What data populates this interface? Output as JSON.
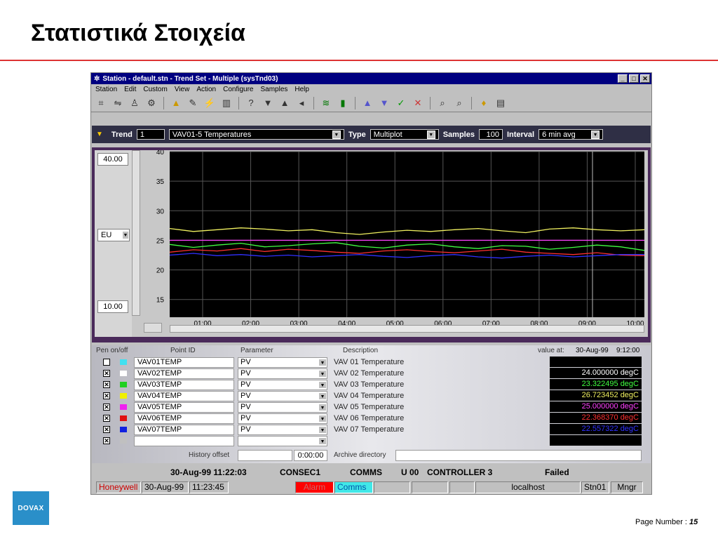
{
  "slide": {
    "title": "Στατιστικά Στοιχεία",
    "page_label": "Page Number :",
    "page_number": "15",
    "logo_text": "DOVAX"
  },
  "window": {
    "title": "Station - default.stn - Trend Set - Multiple (sysTnd03)",
    "menu": [
      "Station",
      "Edit",
      "Custom",
      "View",
      "Action",
      "Configure",
      "Samples",
      "Help"
    ]
  },
  "trendbar": {
    "trend_label": "Trend",
    "trend_value": "1",
    "set_value": "VAV01-5 Temperatures",
    "type_label": "Type",
    "type_value": "Multiplot",
    "samples_label": "Samples",
    "samples_value": "100",
    "interval_label": "Interval",
    "interval_value": "6 min avg"
  },
  "scale": {
    "high": "40.00",
    "low": "10.00",
    "unit": "EU"
  },
  "chart_data": {
    "type": "line",
    "y_ticks": [
      40,
      35,
      30,
      25,
      20,
      15
    ],
    "x_ticks": [
      "01:00",
      "02:00",
      "03:00",
      "04:00",
      "05:00",
      "06:00",
      "07:00",
      "08:00",
      "09:00",
      "10:00"
    ],
    "ylim": [
      12,
      40
    ],
    "series": [
      {
        "color": "#f0f060",
        "values": [
          27,
          26.5,
          26.8,
          27.1,
          26.9,
          26.6,
          26.8,
          26.3,
          26.0,
          26.4,
          26.7,
          26.5,
          26.8,
          27.0,
          26.6,
          26.3,
          26.9,
          27.1,
          26.8,
          26.6,
          26.8
        ]
      },
      {
        "color": "#ff40ff",
        "values": [
          25,
          25,
          25,
          25,
          25,
          25,
          25,
          25,
          25,
          25,
          25,
          25,
          25,
          25,
          25,
          25,
          25,
          25,
          25,
          25,
          25
        ]
      },
      {
        "color": "#40ff40",
        "values": [
          24.3,
          23.8,
          24.2,
          24.5,
          23.9,
          24.1,
          24.4,
          24.6,
          24.0,
          23.7,
          24.2,
          24.4,
          23.9,
          23.6,
          24.1,
          24.0,
          23.5,
          23.8,
          24.2,
          23.9,
          23.3
        ]
      },
      {
        "color": "#ff3030",
        "values": [
          23.0,
          23.4,
          23.2,
          23.6,
          23.1,
          23.5,
          23.3,
          23.0,
          22.8,
          23.2,
          23.4,
          23.1,
          22.9,
          23.2,
          23.5,
          23.0,
          22.8,
          22.6,
          22.9,
          22.5,
          22.4
        ]
      },
      {
        "color": "#3030ff",
        "values": [
          22.5,
          22.8,
          22.4,
          22.6,
          22.3,
          22.5,
          22.2,
          22.4,
          22.6,
          22.3,
          22.1,
          22.4,
          22.6,
          22.2,
          22.0,
          22.3,
          22.5,
          22.2,
          22.4,
          22.6,
          22.6
        ]
      }
    ]
  },
  "pens": {
    "headers": {
      "pen": "Pen on/off",
      "point": "Point ID",
      "param": "Parameter",
      "desc": "Description",
      "value_at": "value at:",
      "date": "30-Aug-99",
      "time": "9:12:00"
    },
    "rows": [
      {
        "on": "",
        "color": "#40e0f0",
        "point": "VAV01TEMP",
        "param": "PV",
        "desc": "VAV 01 Temperature",
        "value": "",
        "vcolor": "#ffffff"
      },
      {
        "on": "✕",
        "color": "#ffffff",
        "point": "VAV02TEMP",
        "param": "PV",
        "desc": "VAV 02 Temperature",
        "value": "24.000000 degC",
        "vcolor": "#ffffff"
      },
      {
        "on": "✕",
        "color": "#20d020",
        "point": "VAV03TEMP",
        "param": "PV",
        "desc": "VAV 03 Temperature",
        "value": "23.322495 degC",
        "vcolor": "#40ff40"
      },
      {
        "on": "✕",
        "color": "#f0f000",
        "point": "VAV04TEMP",
        "param": "PV",
        "desc": "VAV 04 Temperature",
        "value": "26.723452 degC",
        "vcolor": "#f0f060"
      },
      {
        "on": "✕",
        "color": "#f020f0",
        "point": "VAV05TEMP",
        "param": "PV",
        "desc": "VAV 05 Temperature",
        "value": "25.000000 degC",
        "vcolor": "#ff40ff"
      },
      {
        "on": "✕",
        "color": "#e01010",
        "point": "VAV06TEMP",
        "param": "PV",
        "desc": "VAV 06 Temperature",
        "value": "22.368370 degC",
        "vcolor": "#ff3030"
      },
      {
        "on": "✕",
        "color": "#1020e0",
        "point": "VAV07TEMP",
        "param": "PV",
        "desc": "VAV 07 Temperature",
        "value": "22.557322 degC",
        "vcolor": "#3030ff"
      },
      {
        "on": "✕",
        "color": "#c0c0c0",
        "point": "",
        "param": "",
        "desc": "",
        "value": "",
        "vcolor": "#ffffff"
      }
    ],
    "history_label": "History offset",
    "history_value": "0:00:00",
    "archive_label": "Archive directory"
  },
  "alarmline": {
    "date": "30-Aug-99 11:22:03",
    "src": "CONSEC1",
    "cat": "COMMS",
    "unit": "U 00",
    "desc": "CONTROLLER  3",
    "state": "Failed"
  },
  "statusbar": {
    "vendor": "Honeywell",
    "date": "30-Aug-99",
    "time": "11:23:45",
    "alarm": "Alarm",
    "comms": "Comms",
    "host": "localhost",
    "station": "Stn01",
    "role": "Mngr"
  }
}
